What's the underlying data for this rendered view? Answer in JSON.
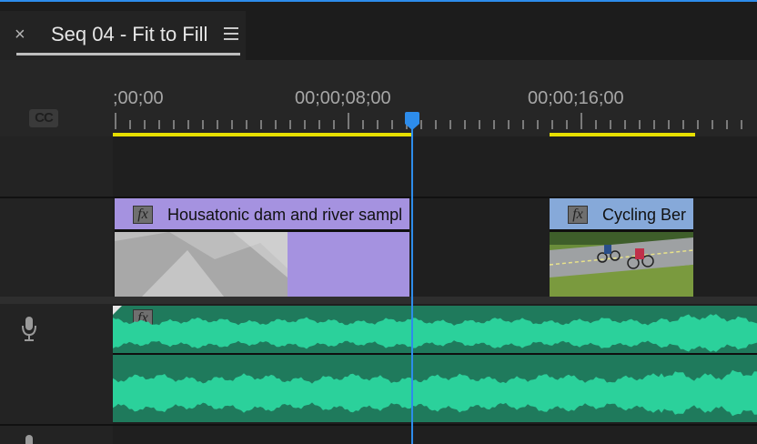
{
  "tab": {
    "close_glyph": "×",
    "title": "Seq 04 - Fit to Fill"
  },
  "ruler": {
    "labels": [
      ";00;00",
      "00;00;08;00",
      "00;00;16;00"
    ]
  },
  "captions_icon": "CC",
  "video_clips": [
    {
      "name": "Housatonic dam and river sampl",
      "fx": "fx",
      "color": "#a592e0"
    },
    {
      "name": "Cycling Ber",
      "fx": "fx",
      "color": "#86a9d9"
    }
  ],
  "audio_clip": {
    "fx": "fx",
    "color": "#2bd19b"
  },
  "colors": {
    "playhead": "#2d8ceb",
    "work_area": "#e7df00",
    "audio_dark": "#1f7a5c"
  }
}
